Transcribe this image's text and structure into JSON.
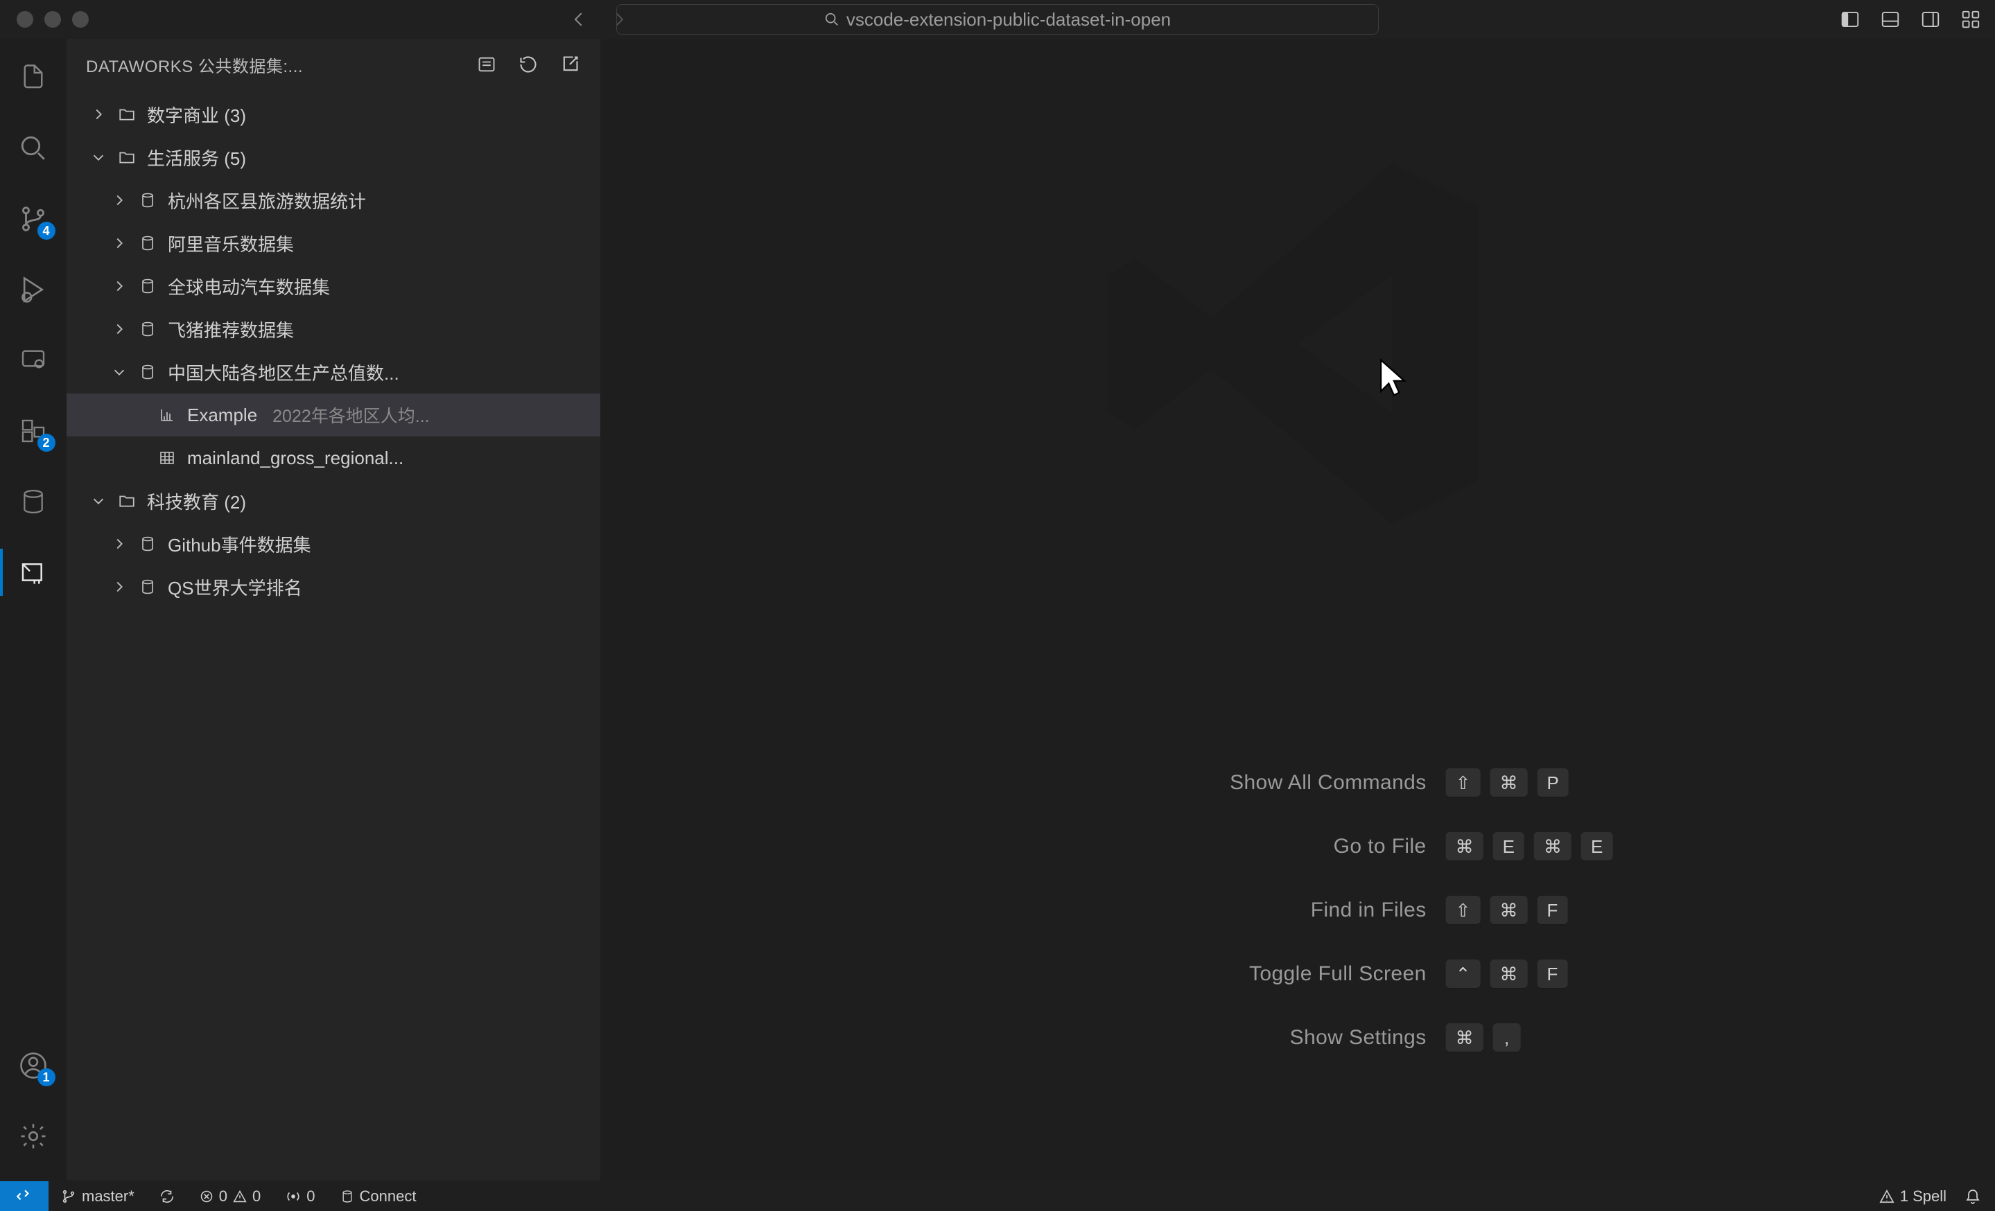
{
  "titlebar": {
    "search_text": "vscode-extension-public-dataset-in-open"
  },
  "activitybar": {
    "scm_badge": "4",
    "extensions_badge": "2",
    "account_badge": "1"
  },
  "sidebar": {
    "title": "DATAWORKS 公共数据集:...",
    "items": {
      "digitalCommerce": "数字商业 (3)",
      "lifeServices": "生活服务 (5)",
      "hangzhou": "杭州各区县旅游数据统计",
      "alimusic": "阿里音乐数据集",
      "ev": "全球电动汽车数据集",
      "fliggy": "飞猪推荐数据集",
      "gdp": "中国大陆各地区生产总值数...",
      "exampleLabel": "Example",
      "exampleDesc": "2022年各地区人均...",
      "grossRegional": "mainland_gross_regional...",
      "techEdu": "科技教育 (2)",
      "github": "Github事件数据集",
      "qs": "QS世界大学排名"
    }
  },
  "shortcuts": {
    "showAll": {
      "label": "Show All Commands",
      "keys": [
        "⇧",
        "⌘",
        "P"
      ]
    },
    "goToFile": {
      "label": "Go to File",
      "keys": [
        "⌘",
        "E",
        "⌘",
        "E"
      ]
    },
    "findInFiles": {
      "label": "Find in Files",
      "keys": [
        "⇧",
        "⌘",
        "F"
      ]
    },
    "fullScreen": {
      "label": "Toggle Full Screen",
      "keys": [
        "⌃",
        "⌘",
        "F"
      ]
    },
    "settings": {
      "label": "Show Settings",
      "keys": [
        "⌘",
        ","
      ]
    }
  },
  "statusbar": {
    "branch": "master*",
    "errors": "0",
    "warnings": "0",
    "ports": "0",
    "connect": "Connect",
    "spell": "1 Spell"
  }
}
